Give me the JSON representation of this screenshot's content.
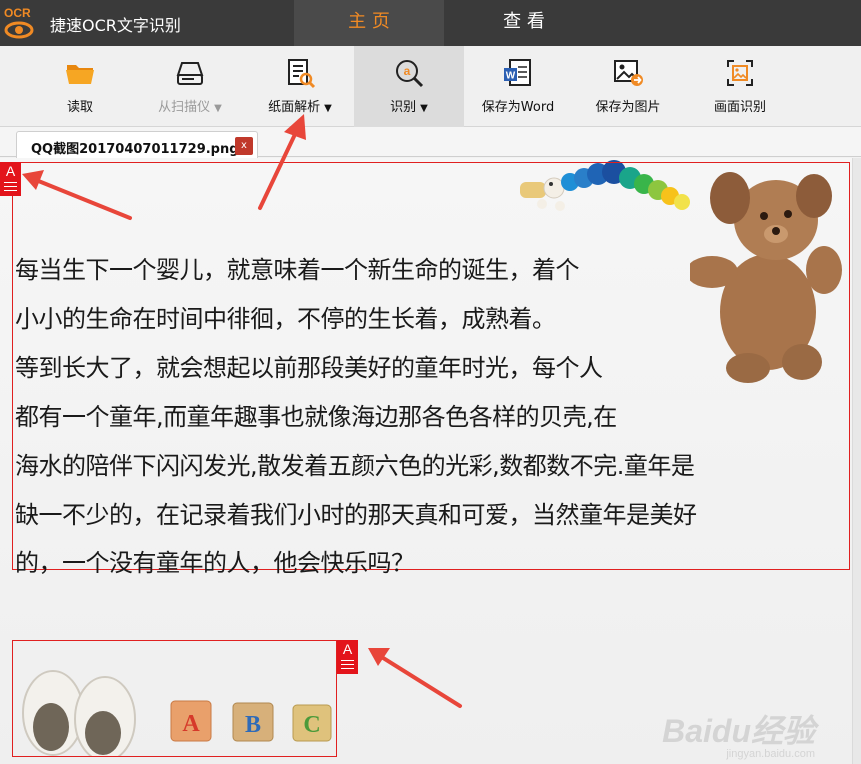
{
  "app": {
    "title": "捷速OCR文字识别",
    "logo_text": "OCR"
  },
  "nav": [
    {
      "label": "主 页",
      "active": true
    },
    {
      "label": "查 看",
      "active": false
    }
  ],
  "toolbar": [
    {
      "label": "读取",
      "icon": "folder-icon",
      "dropdown": false,
      "disabled": false
    },
    {
      "label": "从扫描仪",
      "icon": "scanner-icon",
      "dropdown": true,
      "disabled": true
    },
    {
      "label": "纸面解析",
      "icon": "page-analysis-icon",
      "dropdown": true,
      "disabled": false
    },
    {
      "label": "识别",
      "icon": "recognize-icon",
      "dropdown": true,
      "disabled": false,
      "active": true
    },
    {
      "label": "保存为Word",
      "icon": "word-icon",
      "dropdown": false,
      "disabled": false
    },
    {
      "label": "保存为图片",
      "icon": "save-image-icon",
      "dropdown": false,
      "disabled": false
    },
    {
      "label": "画面识别",
      "icon": "screen-capture-icon",
      "dropdown": false,
      "disabled": false
    }
  ],
  "document_tab": {
    "filename": "QQ截图20170407011729.png",
    "close": "x"
  },
  "regions": [
    {
      "kind": "text",
      "marker": "A"
    },
    {
      "kind": "image",
      "marker": "A"
    }
  ],
  "ocr_text": [
    "每当生下一个婴儿，就意味着一个新生命的诞生，着个",
    "小小的生命在时间中徘徊，不停的生长着，成熟着。",
    "等到长大了，就会想起以前那段美好的童年时光，每个人",
    "都有一个童年,而童年趣事也就像海边那各色各样的贝壳,在",
    "海水的陪伴下闪闪发光,散发着五颜六色的光彩,数都数不完.童年是",
    "缺一不少的，在记录着我们小时的那天真和可爱，当然童年是美好",
    "的，一个没有童年的人，他会快乐吗？"
  ],
  "blocks": [
    "A",
    "B",
    "C"
  ],
  "watermark": {
    "brand": "Baidu经验",
    "url": "jingyan.baidu.com"
  },
  "colors": {
    "accent": "#f08a24",
    "titlebar": "#3a3a3a",
    "region_border": "#e02020",
    "marker": "#e3141b"
  }
}
